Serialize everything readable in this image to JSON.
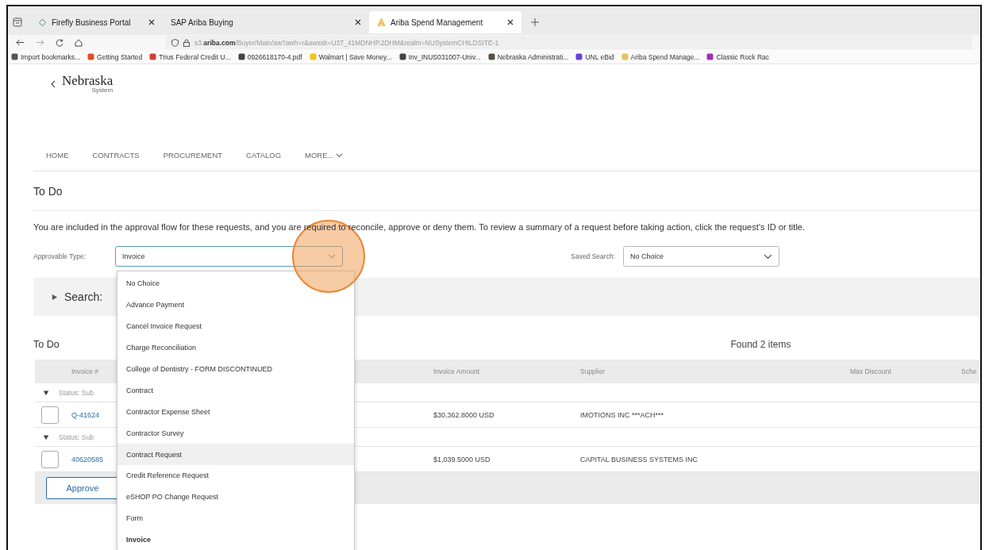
{
  "browser": {
    "tabs": [
      {
        "label": "Firefly Business Portal",
        "selected": false
      },
      {
        "label": "SAP Ariba Buying",
        "selected": false
      },
      {
        "label": "Ariba Spend Management",
        "selected": true
      }
    ],
    "address": "s3.**ariba.com**/Buyer/Main/aw?awh=r&awssk=U37_41MDNHP.2DHM&realm=NUSystemCHILDSITE-1",
    "bookmarks": [
      {
        "label": "Import bookmarks...",
        "color": "#555555"
      },
      {
        "label": "Getting Started",
        "color": "#e0502a"
      },
      {
        "label": "Trius Federal Credit U...",
        "color": "#d04030"
      },
      {
        "label": "0926618170-4.pdf",
        "color": "#444444"
      },
      {
        "label": "Walmart | Save Money...",
        "color": "#f5c022"
      },
      {
        "label": "Inv_INUS031007-Univ...",
        "color": "#444444"
      },
      {
        "label": "Nebraska Administrati...",
        "color": "#5a5040"
      },
      {
        "label": "UNL eBid",
        "color": "#6a3fd8"
      },
      {
        "label": "Ariba Spend Manage...",
        "color": "#e8c060"
      },
      {
        "label": "Classic Rock Rac",
        "color": "#a02fb0"
      }
    ]
  },
  "header": {
    "logo": "Nebraska",
    "logo_sub": "System",
    "nav": [
      {
        "label": "HOME",
        "kind": "link"
      },
      {
        "label": "CONTRACTS",
        "kind": "link"
      },
      {
        "label": "PROCUREMENT",
        "kind": "link"
      },
      {
        "label": "CATALOG",
        "kind": "link"
      },
      {
        "label": "MORE...",
        "kind": "menu"
      }
    ]
  },
  "page_title": "To Do",
  "description": "You are included in the approval flow for these requests, and you are required to reconcile, approve or deny them. To review a summary of a request before taking action, click the request's ID or title.",
  "filters": {
    "approvable_type": {
      "label": "Approvable Type:",
      "value": "Invoice",
      "expanded": true,
      "options": [
        {
          "label": "No Choice",
          "selected": false,
          "highlighted": false
        },
        {
          "label": "Advance Payment",
          "selected": false,
          "highlighted": false
        },
        {
          "label": "Cancel Invoice Request",
          "selected": false,
          "highlighted": false
        },
        {
          "label": "Charge Reconciliation",
          "selected": false,
          "highlighted": false
        },
        {
          "label": "College of Dentistry - FORM DISCONTINUED",
          "selected": false,
          "highlighted": false
        },
        {
          "label": "Contract",
          "selected": false,
          "highlighted": false
        },
        {
          "label": "Contractor Expense Sheet",
          "selected": false,
          "highlighted": false
        },
        {
          "label": "Contractor Survey",
          "selected": false,
          "highlighted": false
        },
        {
          "label": "Contract Request",
          "selected": false,
          "highlighted": true
        },
        {
          "label": "Credit Reference Request",
          "selected": false,
          "highlighted": false
        },
        {
          "label": "eSHOP PO Change Request",
          "selected": false,
          "highlighted": false
        },
        {
          "label": "Form",
          "selected": false,
          "highlighted": false
        },
        {
          "label": "Invoice",
          "selected": true,
          "highlighted": false
        }
      ]
    },
    "saved_search": {
      "label": "Saved Search:",
      "value": "No Choice"
    }
  },
  "search_panel": {
    "label": "Search:",
    "expanded": false
  },
  "results": {
    "title": "To Do",
    "count": "Found 2 items",
    "columns": [
      "Invoice #",
      "Invoice Amount",
      "Supplier",
      "Max Discount",
      "Sche"
    ],
    "groups": [
      {
        "label": "Status: Sub",
        "expanded": true,
        "rows": [
          {
            "invoice": "Q-41624",
            "amount": "$30,362.8000 USD",
            "supplier": "IMOTIONS INC ***ACH***",
            "checked": false
          }
        ]
      },
      {
        "label": "Status: Sub",
        "expanded": true,
        "rows": [
          {
            "invoice": "40620585",
            "amount": "$1,039.5000 USD",
            "supplier": "CAPITAL BUSINESS SYSTEMS INC",
            "checked": false
          }
        ]
      }
    ],
    "actions": [
      "Approve"
    ]
  }
}
